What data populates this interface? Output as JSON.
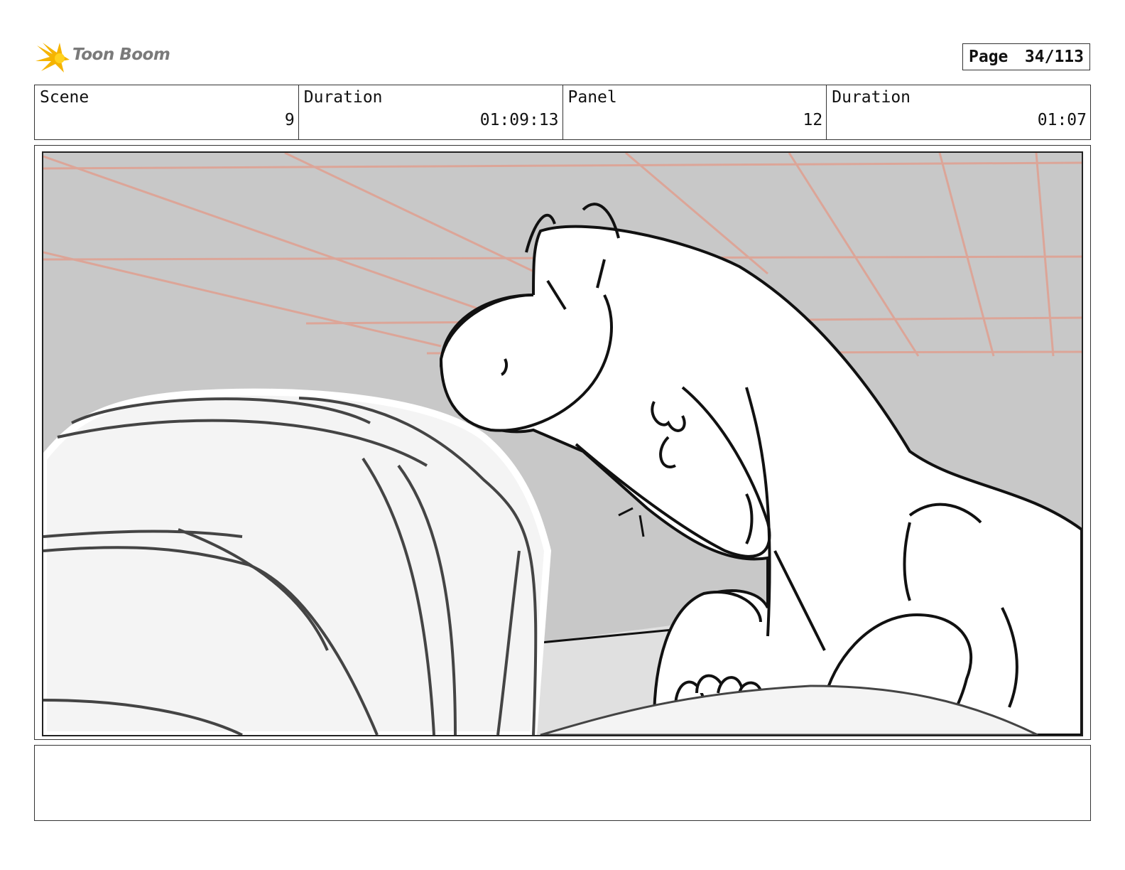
{
  "header": {
    "logo_text": "Toon Boom",
    "page_label": "Page",
    "page_value": "34/113"
  },
  "info": {
    "scene_label": "Scene",
    "scene_value": "9",
    "duration1_label": "Duration",
    "duration1_value": "01:09:13",
    "panel_label": "Panel",
    "panel_value": "12",
    "duration2_label": "Duration",
    "duration2_value": "01:07"
  },
  "panel_image": {
    "icon": "storyboard-sketch-dinosaur"
  },
  "notes": {
    "text": ""
  },
  "colors": {
    "sky": "#c8c8c8",
    "perspective_lines": "#e0a090",
    "ink": "#111111",
    "logo": "#f5b400"
  }
}
